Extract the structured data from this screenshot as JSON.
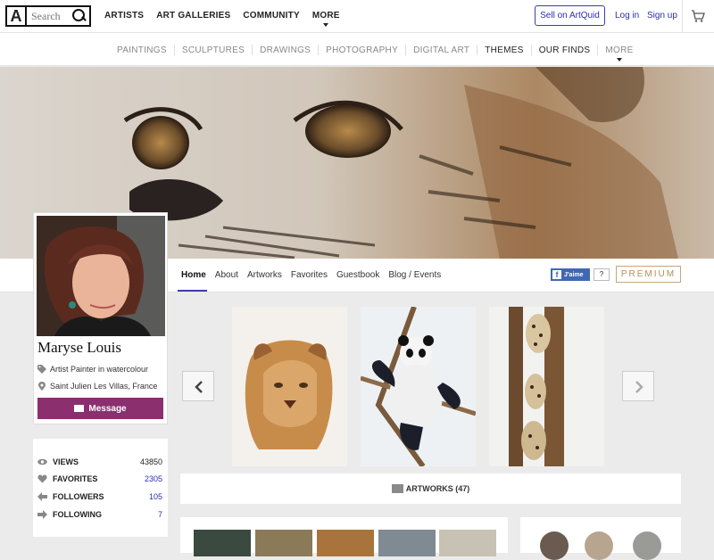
{
  "topbar": {
    "logo_letter": "A",
    "search_placeholder": "Search",
    "nav": [
      "ARTISTS",
      "ART GALLERIES",
      "COMMUNITY",
      "MORE"
    ],
    "sell_label": "Sell on ArtQuid",
    "login_label": "Log in",
    "signup_label": "Sign up"
  },
  "subnav": {
    "items": [
      "PAINTINGS",
      "SCULPTURES",
      "DRAWINGS",
      "PHOTOGRAPHY",
      "DIGITAL ART",
      "THEMES",
      "OUR FINDS",
      "MORE"
    ]
  },
  "profile": {
    "name": "Maryse Louis",
    "title": "Artist Painter in watercolour",
    "location": "Saint Julien Les Villas, France",
    "message_label": "Message"
  },
  "tabs": [
    "Home",
    "About",
    "Artworks",
    "Favorites",
    "Guestbook",
    "Blog / Events"
  ],
  "social": {
    "like_label": "J'aime",
    "like_count": "?",
    "premium_label": "PREMIUM"
  },
  "stats": [
    {
      "label": "VIEWS",
      "value": "43850"
    },
    {
      "label": "FAVORITES",
      "value": "2305"
    },
    {
      "label": "FOLLOWERS",
      "value": "105"
    },
    {
      "label": "FOLLOWING",
      "value": "7"
    }
  ],
  "artworks_label": "ARTWORKS (47)",
  "colors": {
    "accent": "#2d2db0",
    "message_button": "#8c2f6e",
    "premium": "#b48d5a",
    "facebook": "#4267b2"
  }
}
